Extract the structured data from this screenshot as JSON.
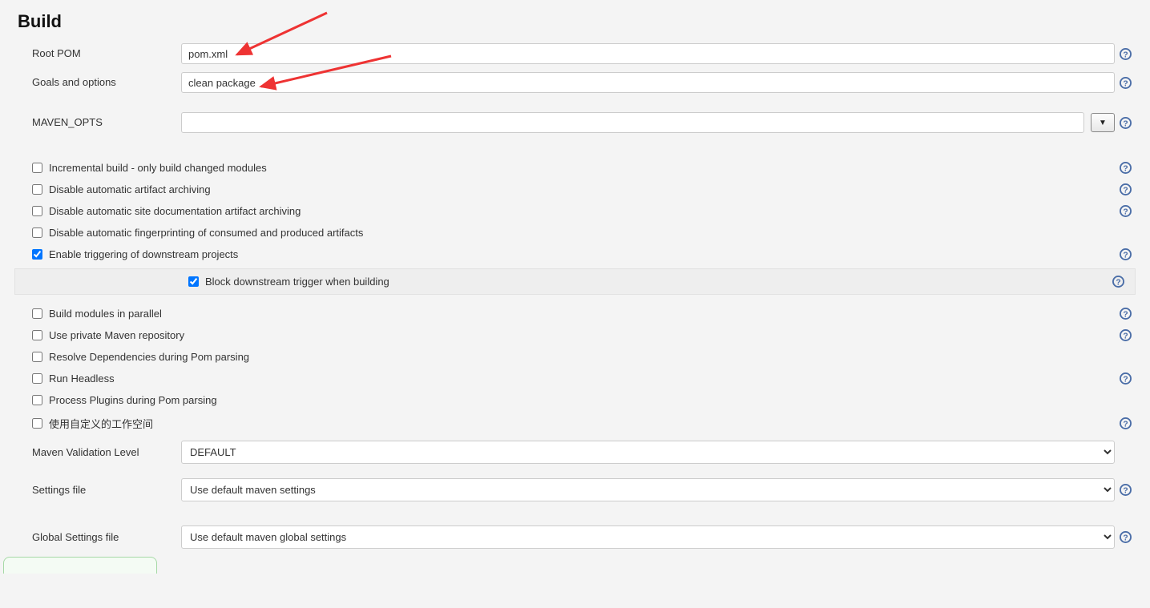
{
  "section": {
    "title": "Build"
  },
  "fields": {
    "root_pom": {
      "label": "Root POM",
      "value": "pom.xml"
    },
    "goals": {
      "label": "Goals and options",
      "value": "clean package"
    },
    "maven_opts": {
      "label": "MAVEN_OPTS",
      "value": ""
    }
  },
  "checkboxes": {
    "incremental": {
      "label": "Incremental build - only build changed modules",
      "checked": false,
      "help": true
    },
    "disable_archive": {
      "label": "Disable automatic artifact archiving",
      "checked": false,
      "help": true
    },
    "disable_site": {
      "label": "Disable automatic site documentation artifact archiving",
      "checked": false,
      "help": true
    },
    "disable_fp": {
      "label": "Disable automatic fingerprinting of consumed and produced artifacts",
      "checked": false,
      "help": false
    },
    "enable_trigger": {
      "label": "Enable triggering of downstream projects",
      "checked": true,
      "help": true
    },
    "block_trigger": {
      "label": "Block downstream trigger when building",
      "checked": true,
      "help": true
    },
    "parallel": {
      "label": "Build modules in parallel",
      "checked": false,
      "help": true
    },
    "private_repo": {
      "label": "Use private Maven repository",
      "checked": false,
      "help": true
    },
    "resolve_deps": {
      "label": "Resolve Dependencies during Pom parsing",
      "checked": false,
      "help": false
    },
    "headless": {
      "label": "Run Headless",
      "checked": false,
      "help": true
    },
    "process_plugins": {
      "label": "Process Plugins during Pom parsing",
      "checked": false,
      "help": false
    },
    "custom_ws": {
      "label": "使用自定义的工作空间",
      "checked": false,
      "help": true
    }
  },
  "validation": {
    "label": "Maven Validation Level",
    "value": "DEFAULT"
  },
  "settings": {
    "label": "Settings file",
    "value": "Use default maven settings"
  },
  "global_settings": {
    "label": "Global Settings file",
    "value": "Use default maven global settings"
  },
  "dropdown_glyph": "▼"
}
